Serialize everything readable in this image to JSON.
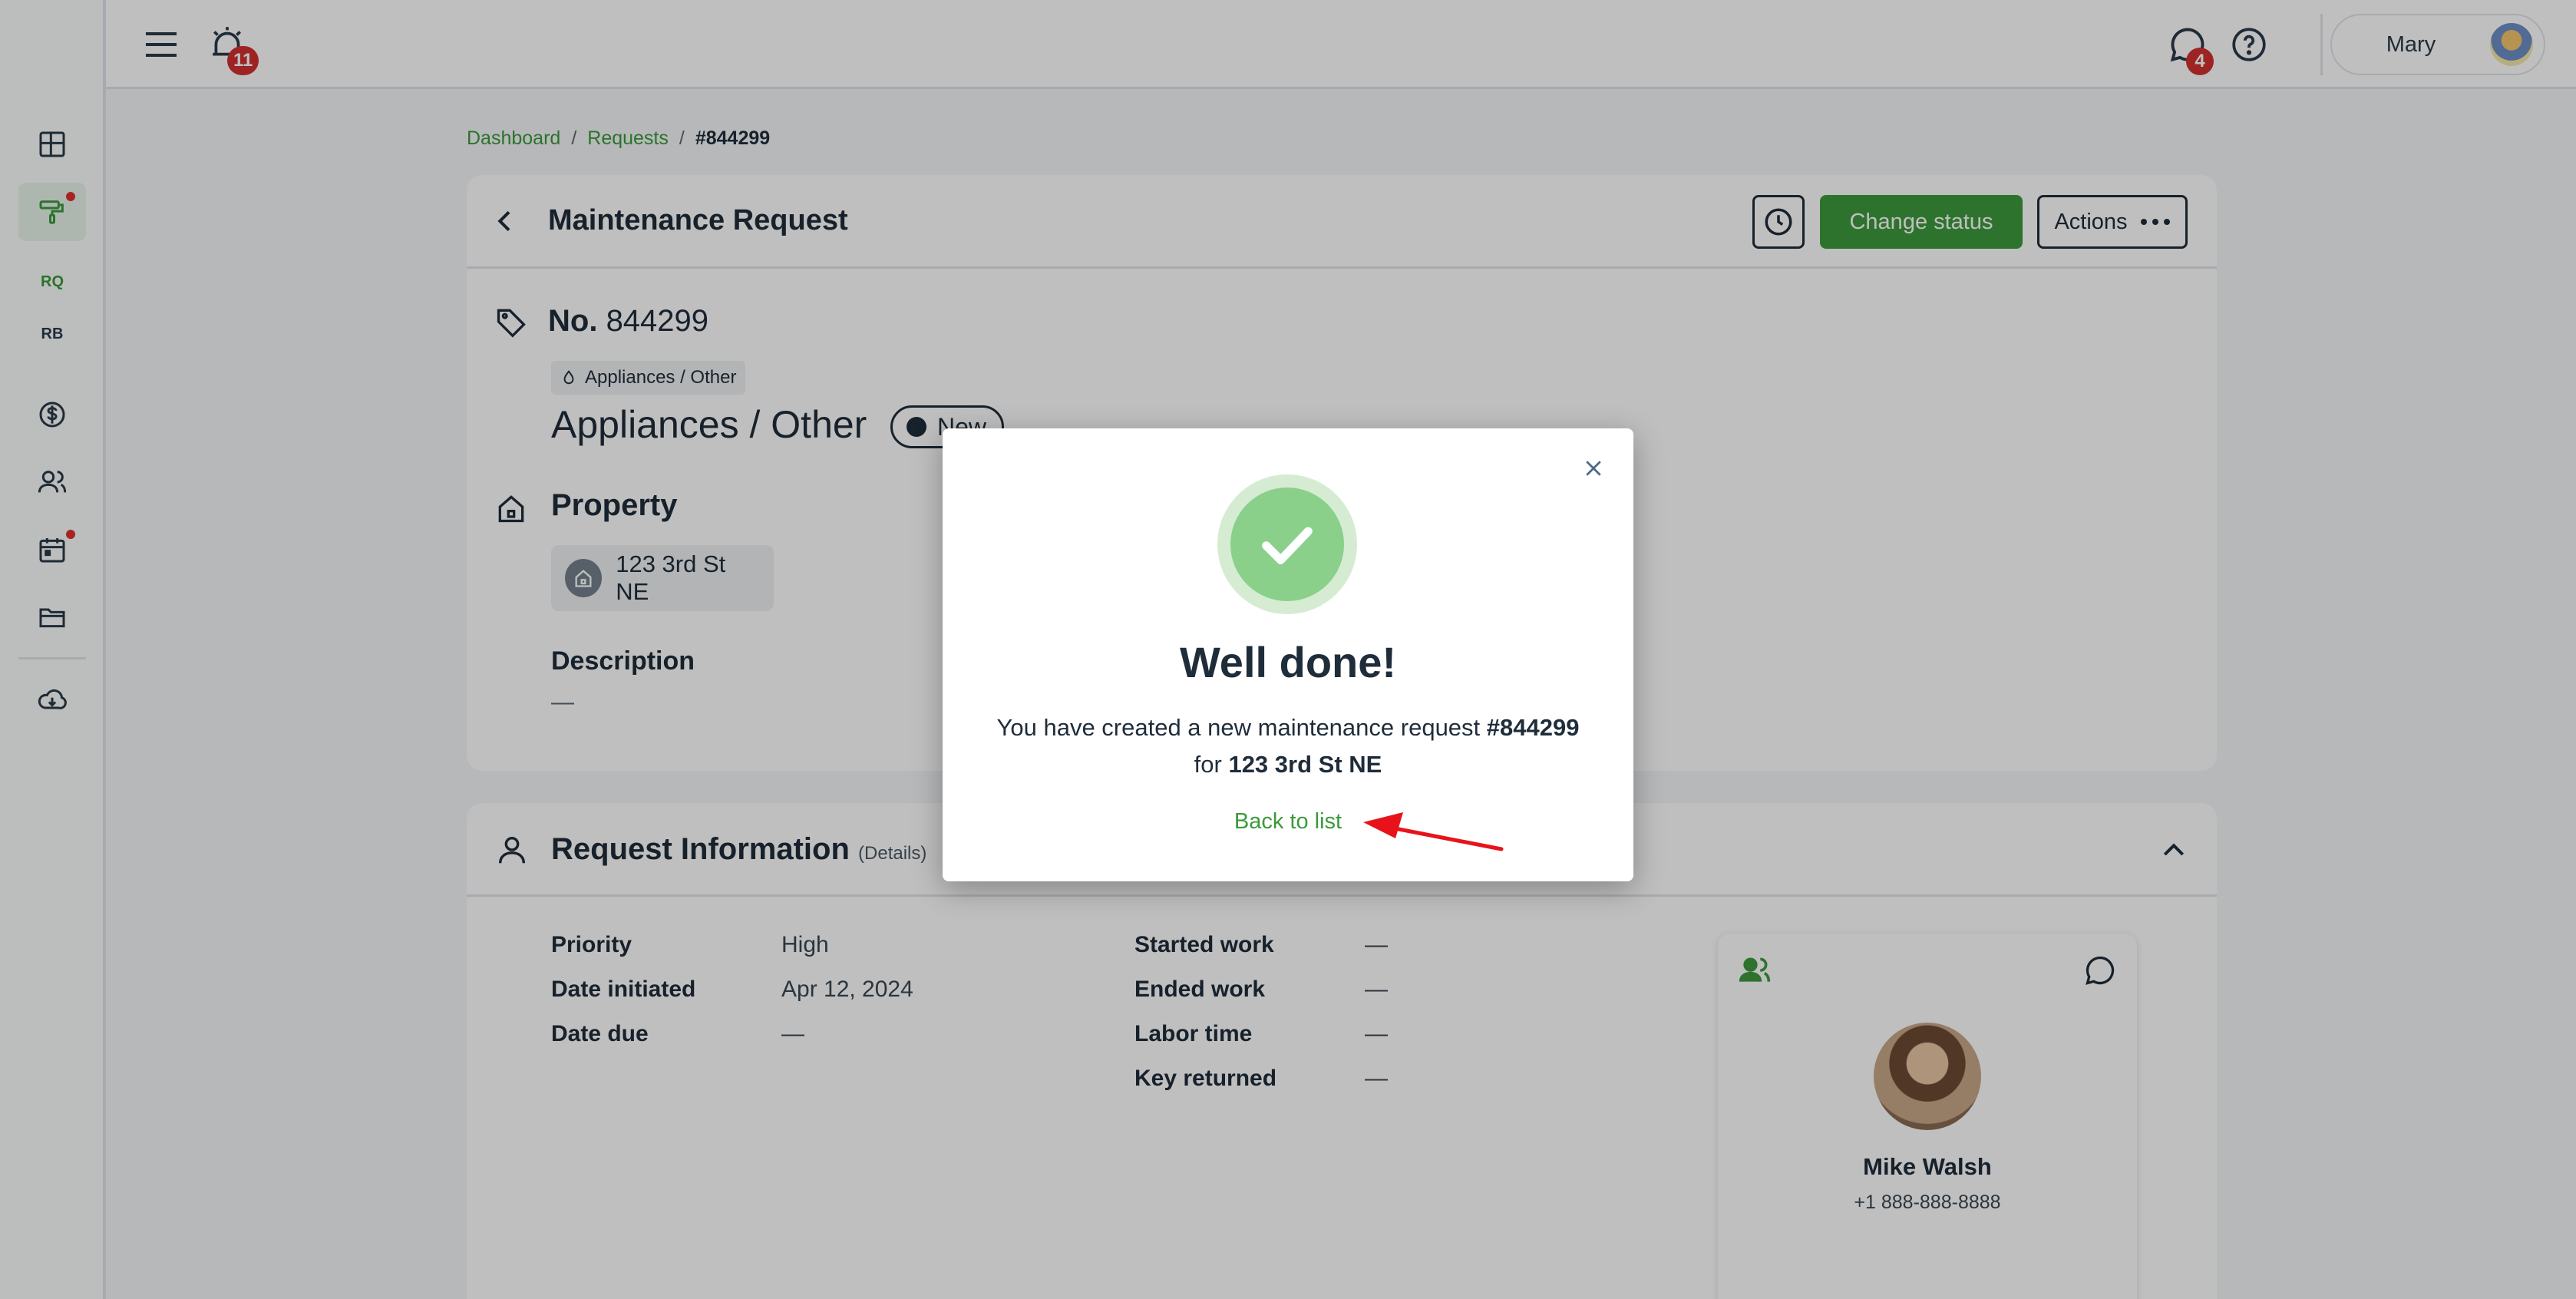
{
  "topbar": {
    "alert_count": "11",
    "messages_count": "4",
    "user_name": "Mary"
  },
  "sidebar": {
    "items": [
      {
        "name": "dashboard-icon"
      },
      {
        "name": "paint-roller-icon",
        "active": true,
        "dot": true
      },
      {
        "label": "RQ"
      },
      {
        "label": "RB"
      },
      {
        "name": "dollar-icon"
      },
      {
        "name": "people-icon"
      },
      {
        "name": "calendar-icon",
        "dot": true
      },
      {
        "name": "folder-icon"
      },
      {
        "name": "cloud-download-icon"
      }
    ]
  },
  "breadcrumb": {
    "items": [
      "Dashboard",
      "Requests"
    ],
    "current": "#844299"
  },
  "request": {
    "header_title": "Maintenance Request",
    "change_status_label": "Change status",
    "actions_label": "Actions",
    "no_label": "No.",
    "no_value": "844299",
    "category_tag": "Appliances / Other",
    "category_title": "Appliances / Other",
    "status": "New",
    "property_title": "Property",
    "property_address": "123 3rd St NE",
    "description_label": "Description",
    "description_value": "—"
  },
  "request_info": {
    "title": "Request Information",
    "subtitle": "(Details)",
    "left_fields": [
      {
        "label": "Priority",
        "value": "High"
      },
      {
        "label": "Date initiated",
        "value": "Apr 12, 2024"
      },
      {
        "label": "Date due",
        "value": "—"
      }
    ],
    "right_fields": [
      {
        "label": "Started work",
        "value": "—"
      },
      {
        "label": "Ended work",
        "value": "—"
      },
      {
        "label": "Labor time",
        "value": "—"
      },
      {
        "label": "Key returned",
        "value": "—"
      }
    ],
    "contact": {
      "name": "Mike Walsh",
      "phone": "+1 888-888-8888"
    }
  },
  "modal": {
    "title": "Well done!",
    "message_prefix": "You have created a new maintenance request ",
    "request_number": "#844299",
    "message_for": " for ",
    "address": "123 3rd St NE",
    "back_link": "Back to list"
  },
  "colors": {
    "accent_green": "#3c9a3c",
    "badge_red": "#d32f2f",
    "annotation_arrow": "#e8131a"
  }
}
